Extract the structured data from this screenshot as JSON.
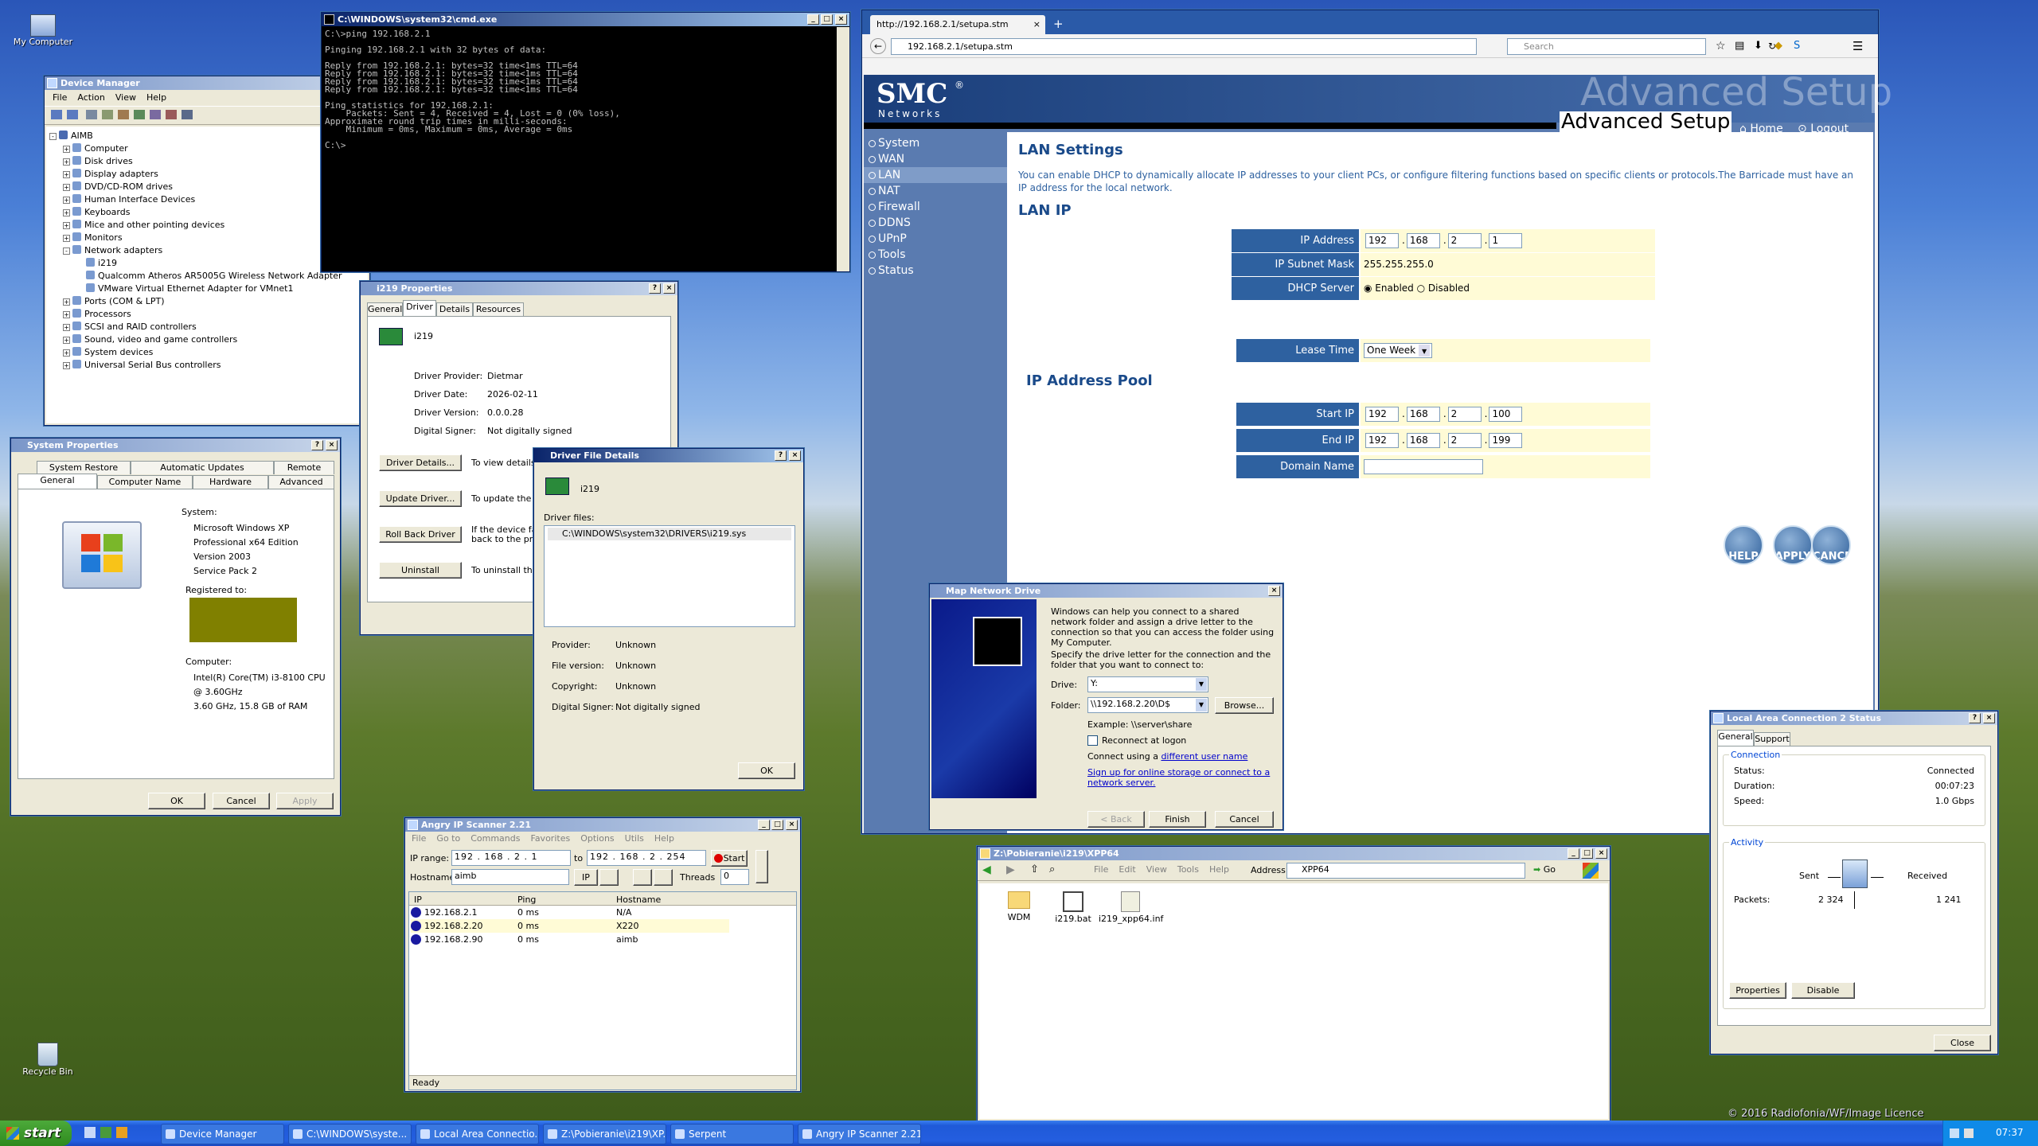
{
  "desktop": {
    "my_computer": "My Computer",
    "recycle_bin": "Recycle Bin",
    "watermark": "© 2016 Radiofonia/WF/Image Licence"
  },
  "cmd": {
    "title": "C:\\WINDOWS\\system32\\cmd.exe",
    "lines": [
      "C:\\>ping 192.168.2.1",
      "",
      "Pinging 192.168.2.1 with 32 bytes of data:",
      "",
      "Reply from 192.168.2.1: bytes=32 time<1ms TTL=64",
      "Reply from 192.168.2.1: bytes=32 time<1ms TTL=64",
      "Reply from 192.168.2.1: bytes=32 time<1ms TTL=64",
      "Reply from 192.168.2.1: bytes=32 time<1ms TTL=64",
      "",
      "Ping statistics for 192.168.2.1:",
      "    Packets: Sent = 4, Received = 4, Lost = 0 (0% loss),",
      "Approximate round trip times in milli-seconds:",
      "    Minimum = 0ms, Maximum = 0ms, Average = 0ms",
      "",
      "C:\\>"
    ]
  },
  "devmgr": {
    "title": "Device Manager",
    "menu": [
      "File",
      "Action",
      "View",
      "Help"
    ],
    "root": "AIMB",
    "items": [
      {
        "t": "Computer",
        "l": 1,
        "pm": "+"
      },
      {
        "t": "Disk drives",
        "l": 1,
        "pm": "+"
      },
      {
        "t": "Display adapters",
        "l": 1,
        "pm": "+"
      },
      {
        "t": "DVD/CD-ROM drives",
        "l": 1,
        "pm": "+"
      },
      {
        "t": "Human Interface Devices",
        "l": 1,
        "pm": "+"
      },
      {
        "t": "Keyboards",
        "l": 1,
        "pm": "+"
      },
      {
        "t": "Mice and other pointing devices",
        "l": 1,
        "pm": "+"
      },
      {
        "t": "Monitors",
        "l": 1,
        "pm": "+"
      },
      {
        "t": "Network adapters",
        "l": 1,
        "pm": "-"
      },
      {
        "t": "i219",
        "l": 2,
        "pm": ""
      },
      {
        "t": "Qualcomm Atheros AR5005G Wireless Network Adapter",
        "l": 2,
        "pm": ""
      },
      {
        "t": "VMware Virtual Ethernet Adapter for VMnet1",
        "l": 2,
        "pm": ""
      },
      {
        "t": "Ports (COM & LPT)",
        "l": 1,
        "pm": "+"
      },
      {
        "t": "Processors",
        "l": 1,
        "pm": "+"
      },
      {
        "t": "SCSI and RAID controllers",
        "l": 1,
        "pm": "+"
      },
      {
        "t": "Sound, video and game controllers",
        "l": 1,
        "pm": "+"
      },
      {
        "t": "System devices",
        "l": 1,
        "pm": "+"
      },
      {
        "t": "Universal Serial Bus controllers",
        "l": 1,
        "pm": "+"
      }
    ]
  },
  "sysprop": {
    "title": "System Properties",
    "tabs_top": [
      "System Restore",
      "Automatic Updates",
      "Remote"
    ],
    "tabs_bottom": [
      "General",
      "Computer Name",
      "Hardware",
      "Advanced"
    ],
    "system_label": "System:",
    "system": [
      "Microsoft Windows XP",
      "Professional x64 Edition",
      "Version 2003",
      "Service Pack 2"
    ],
    "registered_label": "Registered to:",
    "computer_label": "Computer:",
    "computer": [
      "Intel(R) Core(TM) i3-8100 CPU",
      "@ 3.60GHz",
      "3.60 GHz, 15.8 GB of RAM"
    ],
    "ok": "OK",
    "cancel": "Cancel",
    "apply": "Apply"
  },
  "i219": {
    "title": "i219 Properties",
    "tabs": [
      "General",
      "Driver",
      "Details",
      "Resources"
    ],
    "name": "i219",
    "fields": [
      [
        "Driver Provider:",
        "Dietmar"
      ],
      [
        "Driver Date:",
        "2026-02-11"
      ],
      [
        "Driver Version:",
        "0.0.0.28"
      ],
      [
        "Digital Signer:",
        "Not digitally signed"
      ]
    ],
    "buttons": [
      [
        "Driver Details...",
        "To view details"
      ],
      [
        "Update Driver...",
        "To update the"
      ],
      [
        "Roll Back Driver",
        "If the device fa\nback to the pre"
      ],
      [
        "Uninstall",
        "To uninstall the"
      ]
    ]
  },
  "dfd": {
    "title": "Driver File Details",
    "name": "i219",
    "files_label": "Driver files:",
    "file": "C:\\WINDOWS\\system32\\DRIVERS\\i219.sys",
    "fields": [
      [
        "Provider:",
        "Unknown"
      ],
      [
        "File version:",
        "Unknown"
      ],
      [
        "Copyright:",
        "Unknown"
      ],
      [
        "Digital Signer:",
        "Not digitally signed"
      ]
    ],
    "ok": "OK"
  },
  "ipscan": {
    "title": "Angry IP Scanner 2.21",
    "menu": [
      "File",
      "Go to",
      "Commands",
      "Favorites",
      "Options",
      "Utils",
      "Help"
    ],
    "range_label": "IP range:",
    "from": [
      "192",
      "168",
      "2",
      "1"
    ],
    "to_label": "to",
    "to": [
      "192",
      "168",
      "2",
      "254"
    ],
    "start": "Start",
    "hostname_label": "Hostname:",
    "hostname": "aimb",
    "ip_btn": "IP",
    "threads_label": "Threads",
    "threads": "0",
    "cols": [
      "IP",
      "Ping",
      "Hostname"
    ],
    "rows": [
      [
        "192.168.2.1",
        "0 ms",
        "N/A"
      ],
      [
        "192.168.2.20",
        "0 ms",
        "X220"
      ],
      [
        "192.168.2.90",
        "0 ms",
        "aimb"
      ]
    ],
    "status": "Ready"
  },
  "browser": {
    "tab": "http://192.168.2.1/setupa.stm",
    "url": "192.168.2.1/setupa.stm",
    "search": "Search"
  },
  "smc": {
    "logo": "SMC",
    "reg": "®",
    "networks": "Networks",
    "banner": "Advanced Setup",
    "home": "Home",
    "logout": "Logout",
    "nav": [
      "System",
      "WAN",
      "LAN",
      "NAT",
      "Firewall",
      "DDNS",
      "UPnP",
      "Tools",
      "Status"
    ],
    "h_lan": "LAN Settings",
    "intro": "You can enable DHCP to dynamically allocate IP addresses to your client PCs, or configure filtering functions based on specific clients or protocols.The Barricade must have an IP address for the local network.",
    "h_lanip": "LAN IP",
    "ip_label": "IP Address",
    "ip": [
      "192",
      "168",
      "2",
      "1"
    ],
    "mask_label": "IP Subnet Mask",
    "mask": "255.255.255.0",
    "dhcp_label": "DHCP Server",
    "enabled": "Enabled",
    "disabled": "Disabled",
    "lease_label": "Lease Time",
    "lease": "One Week",
    "h_pool": "IP Address Pool",
    "start_label": "Start IP",
    "start": [
      "192",
      "168",
      "2",
      "100"
    ],
    "end_label": "End IP",
    "end": [
      "192",
      "168",
      "2",
      "199"
    ],
    "domain_label": "Domain Name",
    "help": "HELP",
    "apply": "APPLY",
    "cancel": "CANCEL"
  },
  "mapdrive": {
    "title": "Map Network Drive",
    "p1": "Windows can help you connect to a shared network folder and assign a drive letter to the connection so that you can access the folder using My Computer.",
    "p2": "Specify the drive letter for the connection and the folder that you want to connect to:",
    "drive_label": "Drive:",
    "drive": "Y:",
    "folder_label": "Folder:",
    "folder": "\\\\192.168.2.20\\D$",
    "browse": "Browse...",
    "example": "Example: \\\\server\\share",
    "reconnect": "Reconnect at logon",
    "connect_using": "Connect using a ",
    "different_user": "different user name",
    "signup": "Sign up for online storage or connect to a network server.",
    "back": "< Back",
    "finish": "Finish",
    "cancel": "Cancel"
  },
  "explorer": {
    "title": "Z:\\Pobieranie\\i219\\XPP64",
    "menu": [
      "File",
      "Edit",
      "View",
      "Tools",
      "Help"
    ],
    "address_label": "Address",
    "address": "XPP64",
    "go": "Go",
    "files": [
      "WDM",
      "i219.bat",
      "i219_xpp64.inf"
    ]
  },
  "lan": {
    "title": "Local Area Connection 2 Status",
    "tabs": [
      "General",
      "Support"
    ],
    "conn_group": "Connection",
    "status_l": "Status:",
    "status": "Connected",
    "duration_l": "Duration:",
    "duration": "00:07:23",
    "speed_l": "Speed:",
    "speed": "1.0 Gbps",
    "act_group": "Activity",
    "sent": "Sent",
    "received": "Received",
    "packets_l": "Packets:",
    "packets_sent": "2 324",
    "packets_recv": "1 241",
    "properties": "Properties",
    "disable": "Disable",
    "close": "Close"
  },
  "taskbar": {
    "start": "start",
    "items": [
      "Device Manager",
      "C:\\WINDOWS\\syste...",
      "Local Area Connectio...",
      "Z:\\Pobieranie\\i219\\XP...",
      "Serpent",
      "Angry IP Scanner 2.21"
    ],
    "clock": "07:37"
  }
}
